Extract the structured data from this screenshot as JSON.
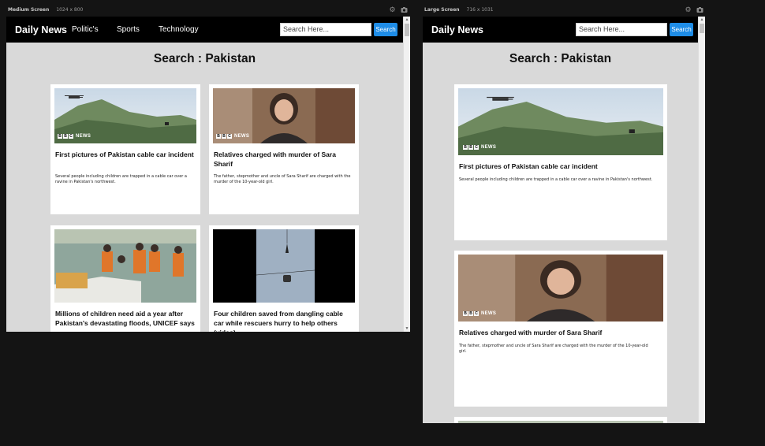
{
  "frames": {
    "medium": {
      "label": "Medium Screen",
      "size": "1024 x 800"
    },
    "large": {
      "label": "Large Screen",
      "size": "716 x 1031"
    }
  },
  "site": {
    "brand": "Daily News",
    "nav": [
      "Politic's",
      "Sports",
      "Technology"
    ],
    "search_placeholder": "Search Here...",
    "search_button": "Search",
    "heading": "Search : Pakistan",
    "bbc_letters": [
      "B",
      "B",
      "C"
    ],
    "bbc_news": "NEWS"
  },
  "articles": [
    {
      "title": "First pictures of Pakistan cable car incident",
      "description": "Several people including children are trapped in a cable car over a ravine in Pakistan's northwest.",
      "image": "mountain-helicopter"
    },
    {
      "title": "Relatives charged with murder of Sara Sharif",
      "description": "The father, stepmother and uncle of Sara Sharif are charged with the murder of the 10-year-old girl.",
      "image": "girl-portrait"
    },
    {
      "title": "Millions of children need aid a year after Pakistan's devastating floods, UNICEF says",
      "description": "",
      "image": "flood-rescue-boat"
    },
    {
      "title": "Four children saved from dangling cable car while rescuers hurry to help others (video)",
      "description": "",
      "image": "cable-car-video"
    }
  ],
  "colors": {
    "navbar": "#000000",
    "page_bg": "#d9d9d9",
    "search_button": "#1e8ce6",
    "card_bg": "#ffffff"
  }
}
